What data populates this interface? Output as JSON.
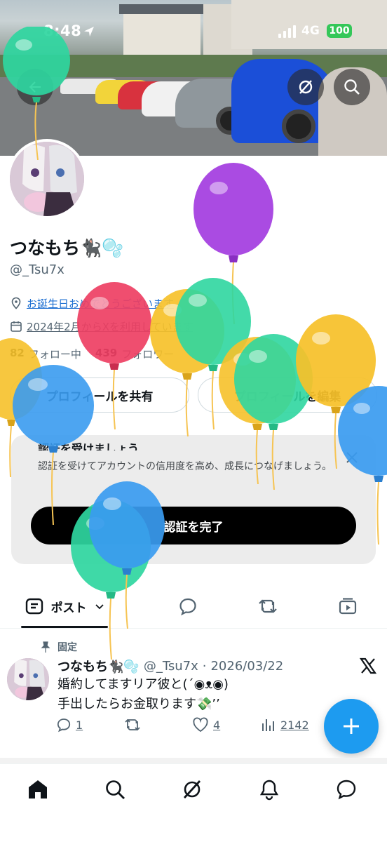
{
  "status_bar": {
    "time": "8:48",
    "network": "4G",
    "battery": "100"
  },
  "profile": {
    "display_name": "つなもち🐈‍⬛🫧",
    "handle": "@_Tsu7x",
    "birthday_text": "お誕生日おめでとうございます",
    "joined_text": "2024年2月からXを利用しています",
    "following_count": "82",
    "following_label": "フォロー中",
    "followers_count": "439",
    "followers_label": "フォロワー",
    "share_button": "プロフィールを共有",
    "edit_button": "プロフィールを編集"
  },
  "verify_card": {
    "title": "認証を受けましょう",
    "body": "認証を受けてアカウントの信用度を高め、成長につなげましょう。",
    "cta": "認証を完了"
  },
  "tabs": {
    "posts_label": "ポスト",
    "icons": [
      "posts-icon",
      "replies-icon",
      "reposts-icon",
      "media-icon"
    ]
  },
  "post": {
    "pinned_label": "固定",
    "author_name": "つなもち🐈‍⬛🫧",
    "author_handle": "@_Tsu7x",
    "separator": "·",
    "date": "2026/03/22",
    "text_line1": "婚約してますリア彼と(´◉ᴥ◉)",
    "text_line2": "手出したらお金取ります💸’’",
    "replies": "1",
    "likes": "4",
    "views": "2142"
  },
  "colors": {
    "accent": "#1d9bf0",
    "link": "#1d6fd1",
    "balloon_green": "#2fd6a0",
    "balloon_purple": "#a541e0",
    "balloon_red": "#ee3f63",
    "balloon_yellow": "#f6c12a",
    "balloon_blue": "#3a9bf0"
  },
  "bottom_nav": [
    "home-icon",
    "search-icon",
    "grok-icon",
    "notifications-icon",
    "messages-icon"
  ]
}
